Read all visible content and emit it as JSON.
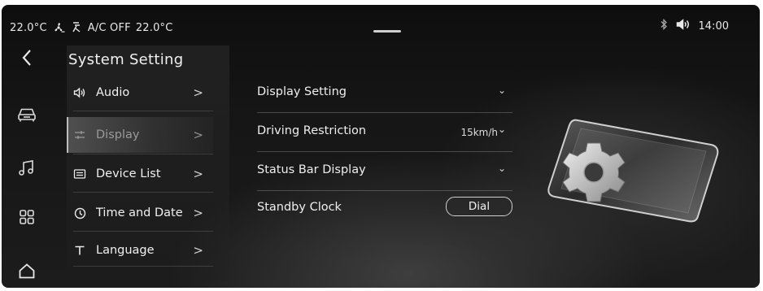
{
  "status": {
    "left_temp": "22.0°C",
    "ac_text": "A/C OFF",
    "right_temp": "22.0°C",
    "time": "14:00"
  },
  "menu": {
    "title": "System Setting",
    "items": [
      {
        "label": "Audio",
        "icon": "speaker-icon"
      },
      {
        "label": "Display",
        "icon": "sliders-icon"
      },
      {
        "label": "Device List",
        "icon": "device-list-icon"
      },
      {
        "label": "Time and Date",
        "icon": "clock-icon"
      },
      {
        "label": "Language",
        "icon": "text-t-icon"
      }
    ],
    "active_index": 1,
    "chevron": ">"
  },
  "settings": {
    "rows": [
      {
        "label": "Display Setting",
        "value": "",
        "indicator": "⌄"
      },
      {
        "label": "Driving Restriction",
        "value": "15km/h",
        "indicator": "⌄"
      },
      {
        "label": "Status Bar Display",
        "value": "",
        "indicator": "⌄"
      },
      {
        "label": "Standby Clock",
        "value": "",
        "indicator": ""
      }
    ],
    "standby_clock_value": "Dial"
  },
  "rail": {
    "icons": [
      "back-icon",
      "car-icon",
      "music-icon",
      "apps-grid-icon",
      "home-icon"
    ]
  }
}
